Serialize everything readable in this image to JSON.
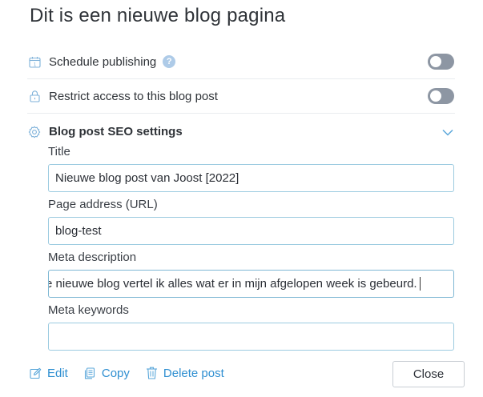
{
  "page": {
    "title": "Dit is een nieuwe blog pagina"
  },
  "settings": {
    "schedule_label": "Schedule publishing",
    "schedule_help": "?",
    "restrict_label": "Restrict access to this blog post",
    "seo_label": "Blog post SEO settings"
  },
  "toggles": {
    "schedule_on": false,
    "restrict_on": false
  },
  "seo": {
    "title_label": "Title",
    "title_value": "Nieuwe blog post van Joost [2022]",
    "url_label": "Page address (URL)",
    "url_value": "blog-test",
    "meta_desc_label": "Meta description",
    "meta_desc_value": "e nieuwe blog vertel ik alles wat er in mijn afgelopen week is gebeurd.",
    "meta_keywords_label": "Meta keywords",
    "meta_keywords_value": ""
  },
  "actions": {
    "edit": "Edit",
    "copy": "Copy",
    "delete": "Delete post",
    "close": "Close"
  },
  "colors": {
    "link": "#2f8fd1",
    "toggle_off": "#8d96a3",
    "field_border": "#9ccbe0"
  },
  "icons": [
    "calendar-icon",
    "help-icon",
    "lock-icon",
    "gear-icon",
    "chevron-down-icon",
    "edit-icon",
    "copy-icon",
    "trash-icon"
  ]
}
